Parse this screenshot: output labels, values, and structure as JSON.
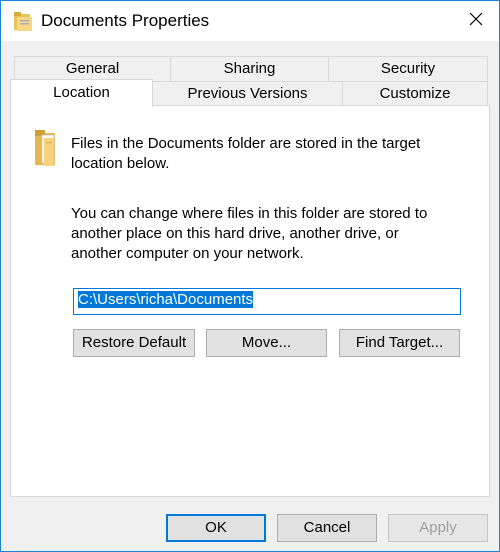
{
  "window": {
    "title": "Documents Properties",
    "icons": {
      "title": "folder-properties-icon",
      "close": "close-icon"
    }
  },
  "tabs": {
    "row1": [
      {
        "label": "General"
      },
      {
        "label": "Sharing"
      },
      {
        "label": "Security"
      }
    ],
    "row2": [
      {
        "label": "Location",
        "active": true
      },
      {
        "label": "Previous Versions"
      },
      {
        "label": "Customize"
      }
    ]
  },
  "location": {
    "folder_icon": "folder-icon",
    "info": "Files in the Documents folder are stored in the target location below.",
    "change_info": "You can change where files in this folder are stored to another place on this hard drive, another drive, or another computer on your network.",
    "path": "C:\\Users\\richa\\Documents",
    "restore_label": "Restore Default",
    "move_label": "Move...",
    "find_target_label": "Find Target..."
  },
  "footer": {
    "ok_label": "OK",
    "cancel_label": "Cancel",
    "apply_label": "Apply"
  },
  "colors": {
    "accent": "#0078d7",
    "window_border": "#1883d7"
  }
}
